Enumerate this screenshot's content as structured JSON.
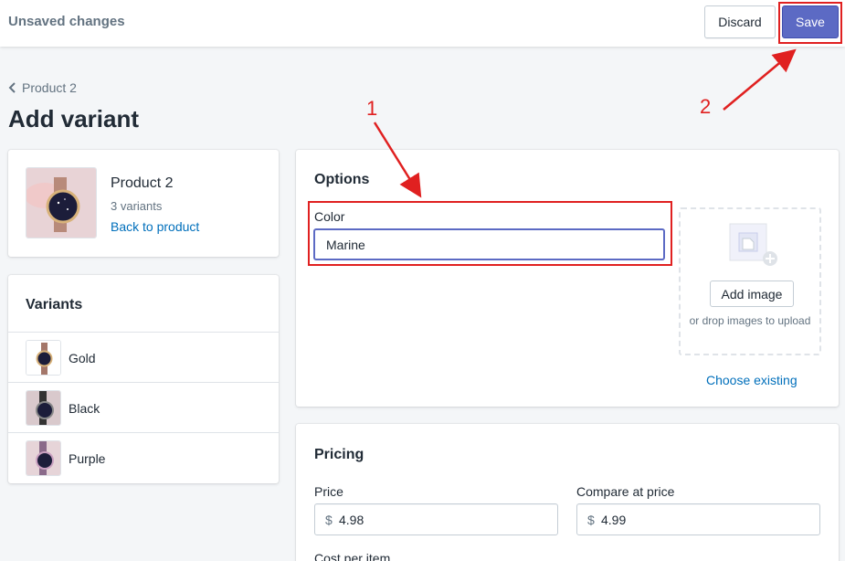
{
  "topbar": {
    "title": "Unsaved changes",
    "discard_label": "Discard",
    "save_label": "Save"
  },
  "breadcrumb": {
    "label": "Product 2"
  },
  "page": {
    "title": "Add variant"
  },
  "product_card": {
    "name": "Product 2",
    "variant_count": "3 variants",
    "back_link": "Back to product"
  },
  "variants": {
    "heading": "Variants",
    "items": [
      {
        "label": "Gold"
      },
      {
        "label": "Black"
      },
      {
        "label": "Purple"
      }
    ]
  },
  "options": {
    "heading": "Options",
    "color_label": "Color",
    "color_value": "Marine",
    "add_image_label": "Add image",
    "drop_text": "or drop images to upload",
    "choose_existing": "Choose existing"
  },
  "pricing": {
    "heading": "Pricing",
    "price_label": "Price",
    "price_prefix": "$",
    "price_value": "4.98",
    "compare_label": "Compare at price",
    "compare_prefix": "$",
    "compare_value": "4.99",
    "cost_label": "Cost per item"
  },
  "annotations": {
    "step1": "1",
    "step2": "2"
  },
  "colors": {
    "accent": "#5c6ac4",
    "link": "#006fbb",
    "annotation": "#e02020",
    "background": "#f4f6f8"
  },
  "icons": [
    "chevron-left-icon",
    "image-placeholder-icon",
    "watch-thumbnail-icon"
  ]
}
